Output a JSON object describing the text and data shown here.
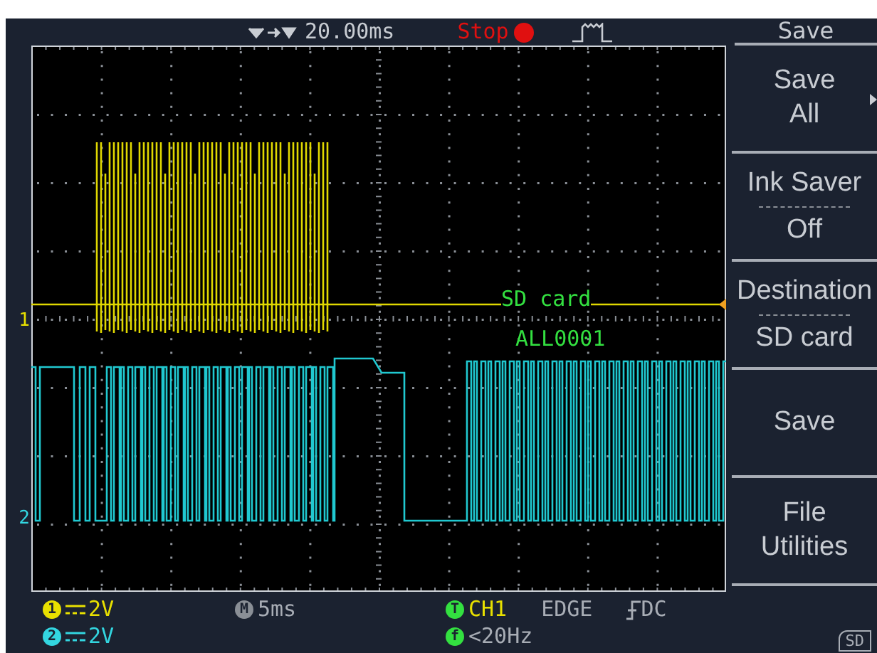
{
  "header": {
    "trigger_position": "20.00ms",
    "run_state": "Stop",
    "menu_title": "Save"
  },
  "display": {
    "channel_markers": [
      "1",
      "2"
    ],
    "annotations": [
      "SD card",
      "ALL0001"
    ]
  },
  "menu": [
    {
      "kind": "submenu",
      "label": "Save All"
    },
    {
      "kind": "option",
      "label": "Ink Saver",
      "value": "Off"
    },
    {
      "kind": "option",
      "label": "Destination",
      "value": "SD card"
    },
    {
      "kind": "action",
      "label": "Save"
    },
    {
      "kind": "action",
      "label": "File Utilities"
    }
  ],
  "status": {
    "channels": [
      {
        "badge": "1",
        "scale": "2V",
        "color": "#e8e000"
      },
      {
        "badge": "2",
        "scale": "2V",
        "color": "#33d6e0"
      }
    ],
    "timebase": {
      "badge": "M",
      "value": "5ms"
    },
    "trigger": {
      "badge": "T",
      "source": "CH1",
      "type": "EDGE",
      "coupling": "DC"
    },
    "frequency": {
      "badge": "f",
      "value": "<20Hz"
    },
    "storage": "SD"
  }
}
